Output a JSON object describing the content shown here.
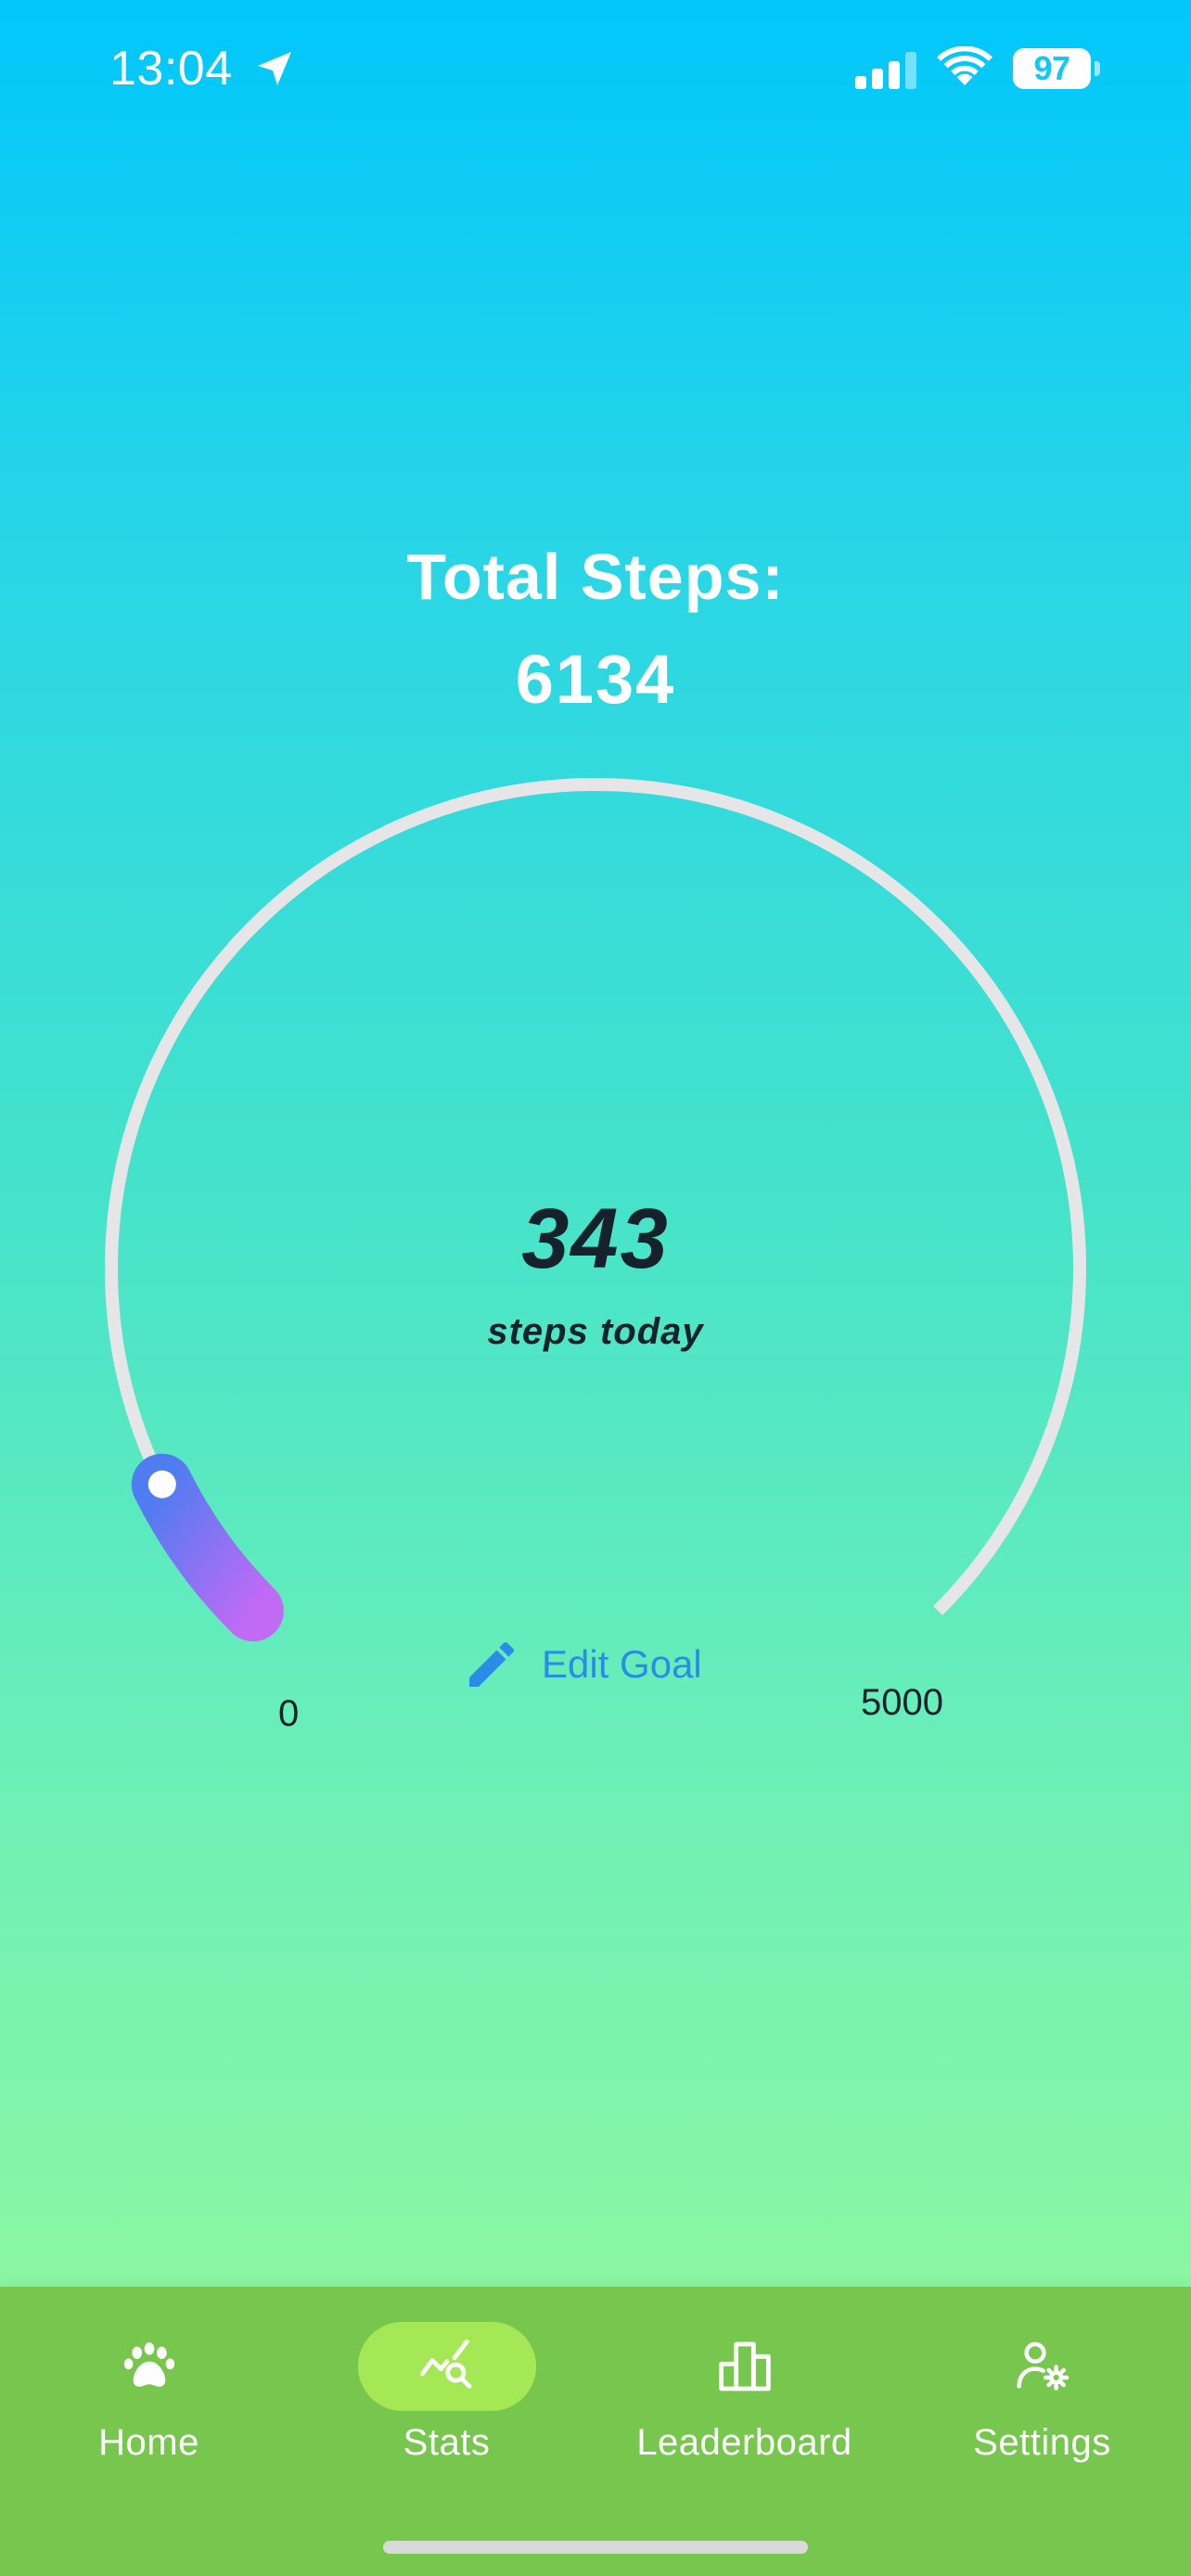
{
  "status_bar": {
    "time": "13:04",
    "battery": "97",
    "icons": [
      "location-arrow-icon",
      "cellular-signal-icon",
      "wifi-icon",
      "battery-icon"
    ]
  },
  "header": {
    "title": "Total Steps:",
    "total_steps": "6134"
  },
  "gauge": {
    "value": 343,
    "min": 0,
    "max": 5000,
    "value_label": "343",
    "unit_label": "steps today",
    "min_label": "0",
    "max_label": "5000",
    "track_color": "#e6e6e8",
    "progress_gradient": [
      "#4f7cf0",
      "#c06af5"
    ]
  },
  "edit_goal": {
    "label": "Edit Goal",
    "icon": "pencil-icon",
    "color": "#2b8ce8"
  },
  "bottom_nav": {
    "background": "#77c74f",
    "active_pill": "#a4e955",
    "items": [
      {
        "label": "Home",
        "icon": "paw-icon",
        "active": false
      },
      {
        "label": "Stats",
        "icon": "stats-search-icon",
        "active": true
      },
      {
        "label": "Leaderboard",
        "icon": "leaderboard-icon",
        "active": false
      },
      {
        "label": "Settings",
        "icon": "user-settings-icon",
        "active": false
      }
    ]
  }
}
